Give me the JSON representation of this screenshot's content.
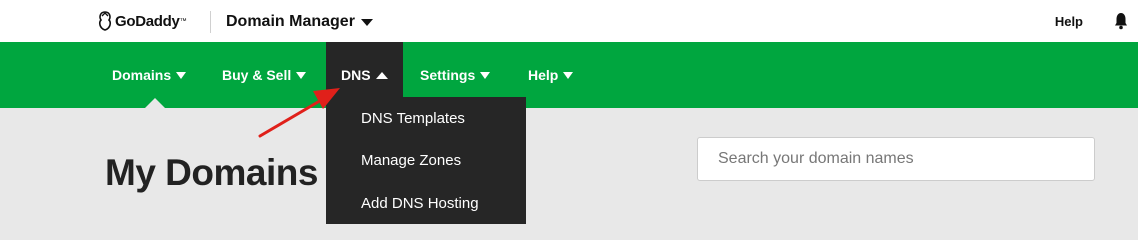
{
  "brand": {
    "name": "GoDaddy",
    "tm": "™"
  },
  "topbar": {
    "app_title": "Domain Manager",
    "help_label": "Help"
  },
  "nav": {
    "items": [
      {
        "label": "Domains"
      },
      {
        "label": "Buy & Sell"
      },
      {
        "label": "DNS"
      },
      {
        "label": "Settings"
      },
      {
        "label": "Help"
      }
    ]
  },
  "dns_menu": {
    "items": [
      {
        "label": "DNS Templates"
      },
      {
        "label": "Manage Zones"
      },
      {
        "label": "Add DNS Hosting"
      }
    ]
  },
  "main": {
    "title": "My Domains",
    "search_placeholder": "Search your domain names"
  },
  "icons": {
    "logo": "godaddy-logo-icon",
    "bell": "bell-icon",
    "annotation": "red-arrow-annotation"
  },
  "colors": {
    "nav_green": "#00a63f",
    "dropdown_bg": "#262626",
    "page_bg": "#e8e8e8",
    "annotation_red": "#e0201a"
  }
}
